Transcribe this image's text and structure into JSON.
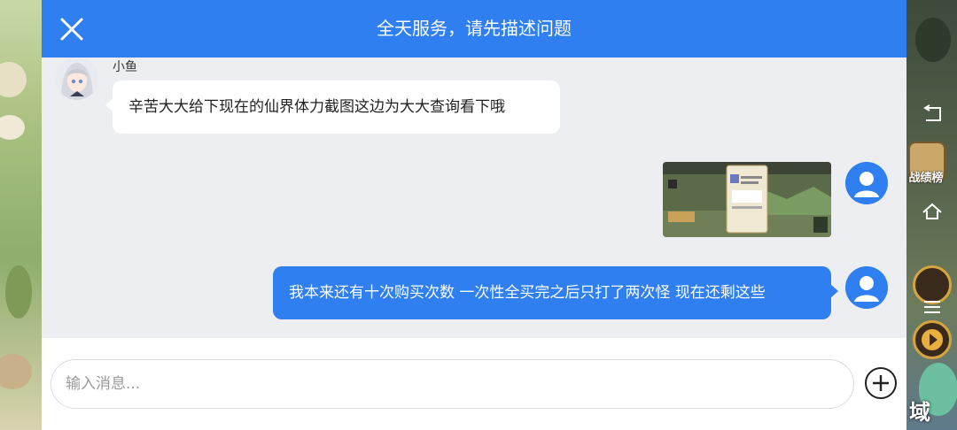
{
  "header": {
    "title": "全天服务，请先描述问题",
    "close_icon": "close-icon",
    "background_color": "#2f7ff0"
  },
  "messages": [
    {
      "side": "left",
      "sender": "小鱼",
      "avatar": "anime-girl-avatar",
      "text": "辛苦大大给下现在的仙界体力截图这边为大大查询看下哦"
    },
    {
      "side": "right",
      "type": "image",
      "avatar": "user-avatar-icon",
      "image": "game-screenshot-thumbnail"
    },
    {
      "side": "right",
      "avatar": "user-avatar-icon",
      "text": "我本来还有十次购买次数 一次性全买完之后只打了两次怪 现在还剩这些"
    }
  ],
  "input": {
    "placeholder": "输入消息...",
    "value": "",
    "add_icon": "plus-circle-icon"
  },
  "game_background": {
    "rank_label": "战绩榜",
    "domain_label": "域",
    "back_icon": "back-arrow-icon",
    "home_icon": "home-icon",
    "menu_icon": "menu-icon"
  }
}
